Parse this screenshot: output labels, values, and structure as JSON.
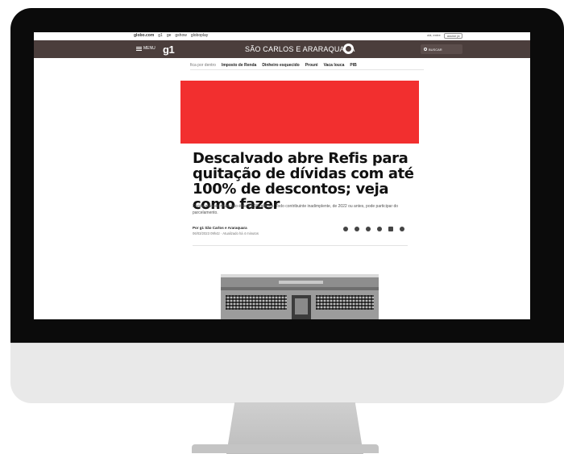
{
  "topbar": {
    "links": [
      "globo.com",
      "g1",
      "ge",
      "gshow",
      "globoplay"
    ],
    "right": {
      "account": "olá, entre",
      "button": "assine já"
    }
  },
  "navbar": {
    "menu_label": "MENU",
    "logo": "g1",
    "region": "SÃO CARLOS E ARARAQUARA",
    "search_label": "BUSCAR",
    "bg_color": "#4b3e3c"
  },
  "subnav": {
    "lead": "fica por dentro",
    "items": [
      "Imposto de Renda",
      "Dinheiro esquecido",
      "Prouni",
      "Vaca louca",
      "PIB"
    ]
  },
  "article": {
    "hero_color": "#f22f2f",
    "headline": "Descalvado abre Refis para quitação de dívidas com até 100% de descontos; veja como fazer",
    "subtitle": "Dívida ativa do município é de R$ 30 milhões. Todo contribuinte inadimplente, de 2022 ou antes, pode participar do parcelamento.",
    "byline": "Por g1 São Carlos e Araraquara",
    "dateline": "06/03/2023 09h42 · Atualizado há 4 minutos",
    "share_icons": [
      "facebook-icon",
      "twitter-icon",
      "whatsapp-icon",
      "pinterest-icon",
      "linkedin-icon",
      "share-icon"
    ]
  }
}
